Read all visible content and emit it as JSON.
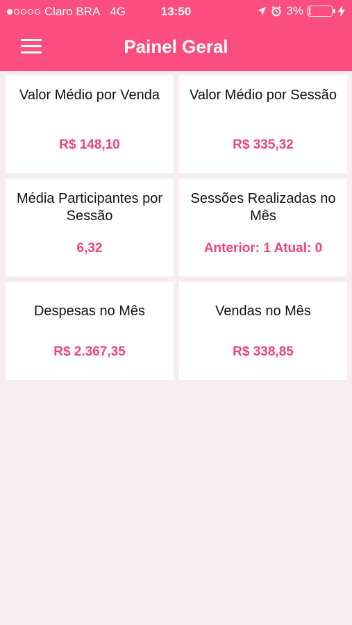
{
  "status_bar": {
    "carrier": "Claro BRA",
    "network": "4G",
    "time": "13:50",
    "battery": "3%",
    "signal_bars_filled": 1,
    "signal_bars_total": 5,
    "icons": [
      "location-arrow-icon",
      "alarm-icon",
      "battery-icon",
      "charging-bolt-icon"
    ]
  },
  "header": {
    "title": "Painel Geral",
    "menu_icon": "hamburger-menu-icon"
  },
  "colors": {
    "header_bg": "#fb4d7f",
    "value_text": "#f0427a",
    "page_bg": "#f7ecf0",
    "card_bg": "#ffffff"
  },
  "cards": [
    {
      "label": "Valor Médio por Venda",
      "value": "R$ 148,10"
    },
    {
      "label": "Valor Médio por Sessão",
      "value": "R$ 335,32"
    },
    {
      "label": "Média Participantes por Sessão",
      "value": "6,32"
    },
    {
      "label": "Sessões Realizadas no Mês",
      "value": "Anterior: 1 Atual: 0"
    },
    {
      "label": "Despesas no Mês",
      "value": "R$ 2.367,35"
    },
    {
      "label": "Vendas no Mês",
      "value": "R$ 338,85"
    }
  ]
}
